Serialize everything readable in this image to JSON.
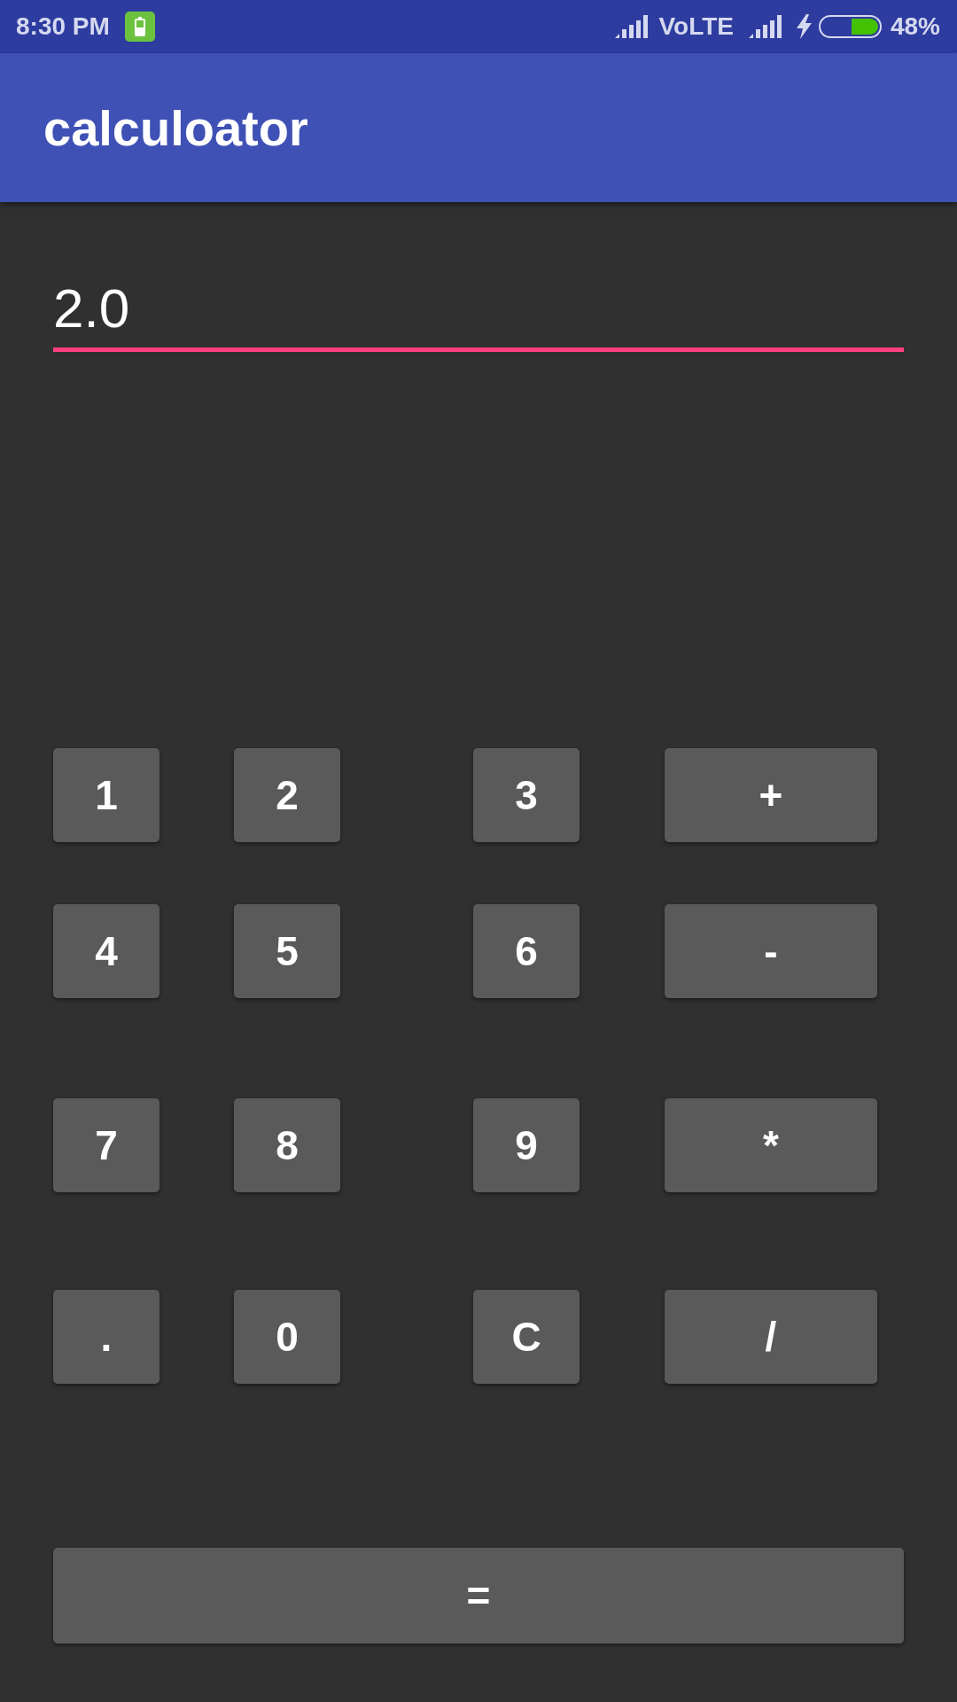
{
  "status_bar": {
    "time": "8:30 PM",
    "network_label": "VoLTE",
    "battery_percent": "48%"
  },
  "app_bar": {
    "title": "calculoator"
  },
  "display": {
    "value": "2.0"
  },
  "keypad": {
    "keys": [
      {
        "label": "1",
        "kind": "digit"
      },
      {
        "label": "2",
        "kind": "digit"
      },
      {
        "label": "3",
        "kind": "digit"
      },
      {
        "label": "+",
        "kind": "operator"
      },
      {
        "label": "4",
        "kind": "digit"
      },
      {
        "label": "5",
        "kind": "digit"
      },
      {
        "label": "6",
        "kind": "digit"
      },
      {
        "label": "-",
        "kind": "operator"
      },
      {
        "label": "7",
        "kind": "digit"
      },
      {
        "label": "8",
        "kind": "digit"
      },
      {
        "label": "9",
        "kind": "digit"
      },
      {
        "label": "*",
        "kind": "operator"
      },
      {
        "label": ".",
        "kind": "decimal"
      },
      {
        "label": "0",
        "kind": "digit"
      },
      {
        "label": "C",
        "kind": "clear"
      },
      {
        "label": "/",
        "kind": "operator"
      }
    ],
    "equals": {
      "label": "="
    }
  }
}
